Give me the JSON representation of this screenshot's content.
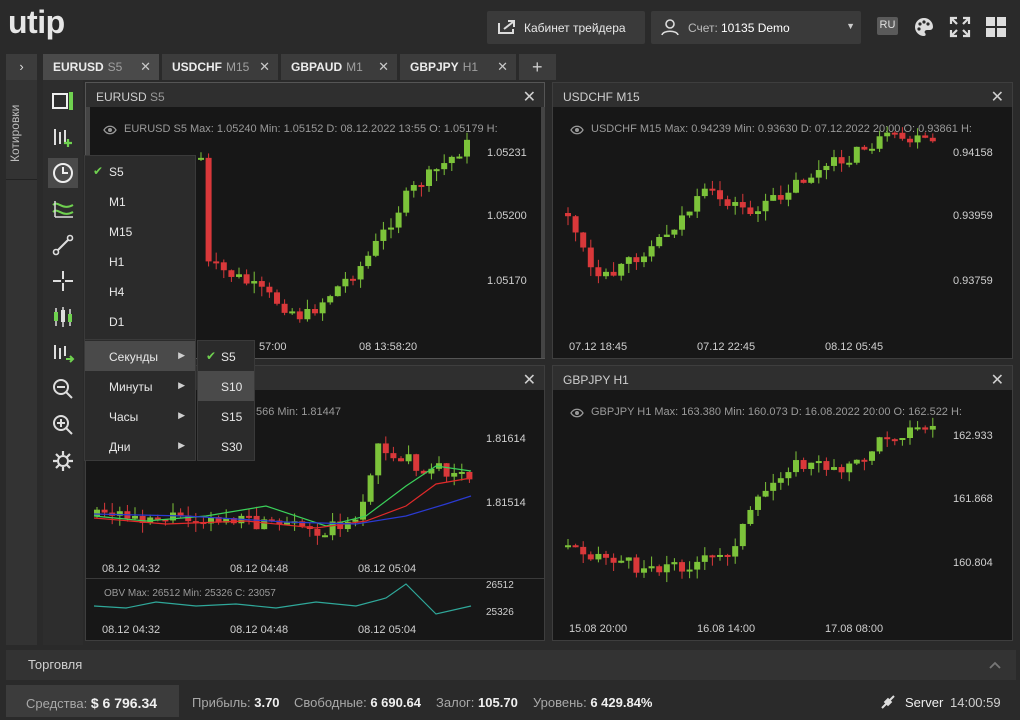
{
  "header": {
    "logo": "utip",
    "cabinet_label": "Кабинет трейдера",
    "account_label": "Счет:",
    "account_value": "10135 Demo",
    "lang": "RU"
  },
  "tabs": [
    {
      "symbol": "EURUSD",
      "period": "S5"
    },
    {
      "symbol": "USDCHF",
      "period": "M15"
    },
    {
      "symbol": "GBPAUD",
      "period": "M1"
    },
    {
      "symbol": "GBPJPY",
      "period": "H1"
    }
  ],
  "sidebar": {
    "quotes_label": "Котировки"
  },
  "panels": {
    "eurusd": {
      "symbol": "EURUSD",
      "period": "S5",
      "info": "EURUSD  S5  Max: 1.05240  Min: 1.05152  D: 08.12.2022 13:55  O: 1.05179  H:",
      "price_ticks": [
        "1.05231",
        "1.05200",
        "1.05170"
      ],
      "time_ticks": [
        "57:00",
        "08 13:58:20"
      ]
    },
    "usdchf": {
      "symbol": "USDCHF",
      "period": "M15",
      "info": "USDCHF  M15  Max: 0.94239  Min: 0.93630  D: 07.12.2022 20:00  O: 0.93861  H:",
      "price_ticks": [
        "0.94158",
        "0.93959",
        "0.93759"
      ],
      "time_ticks": [
        "07.12 18:45",
        "07.12 22:45",
        "08.12 05:45"
      ]
    },
    "gbpaud": {
      "info": "566  Min: 1.81447",
      "price_ticks": [
        "1.81614",
        "1.81514"
      ],
      "time_ticks": [
        "08.12 04:32",
        "08.12 04:48",
        "08.12 05:04"
      ],
      "obv_info": "OBV  Max: 26512  Min: 25326  C: 23057",
      "obv_ticks": [
        "26512",
        "25326"
      ],
      "obv_time_ticks": [
        "08.12 04:32",
        "08.12 04:48",
        "08.12 05:04"
      ]
    },
    "gbpjpy": {
      "symbol": "GBPJPY",
      "period": "H1",
      "info": "GBPJPY  H1  Max: 163.380  Min: 160.073  D: 16.08.2022 20:00  O: 162.522  H:",
      "price_ticks": [
        "162.933",
        "161.868",
        "160.804"
      ],
      "time_ticks": [
        "15.08 20:00",
        "16.08 14:00",
        "17.08 08:00"
      ]
    }
  },
  "period_menu": {
    "items": [
      "S5",
      "M1",
      "M15",
      "H1",
      "H4",
      "D1"
    ],
    "groups": [
      "Секунды",
      "Минуты",
      "Часы",
      "Дни"
    ],
    "seconds": [
      "S5",
      "S10",
      "S15",
      "S30"
    ]
  },
  "trading_label": "Торговля",
  "status": {
    "funds_label": "Средства:",
    "funds_value": "$ 6 796.34",
    "profit_label": "Прибыль:",
    "profit_value": "3.70",
    "free_label": "Свободные:",
    "free_value": "6 690.64",
    "margin_label": "Залог:",
    "margin_value": "105.70",
    "level_label": "Уровень:",
    "level_value": "6 429.84%",
    "server_label": "Server",
    "time": "14:00:59"
  },
  "colors": {
    "bull": "#7cc33a",
    "bear": "#d9383a",
    "accent": "#6fd14f"
  }
}
